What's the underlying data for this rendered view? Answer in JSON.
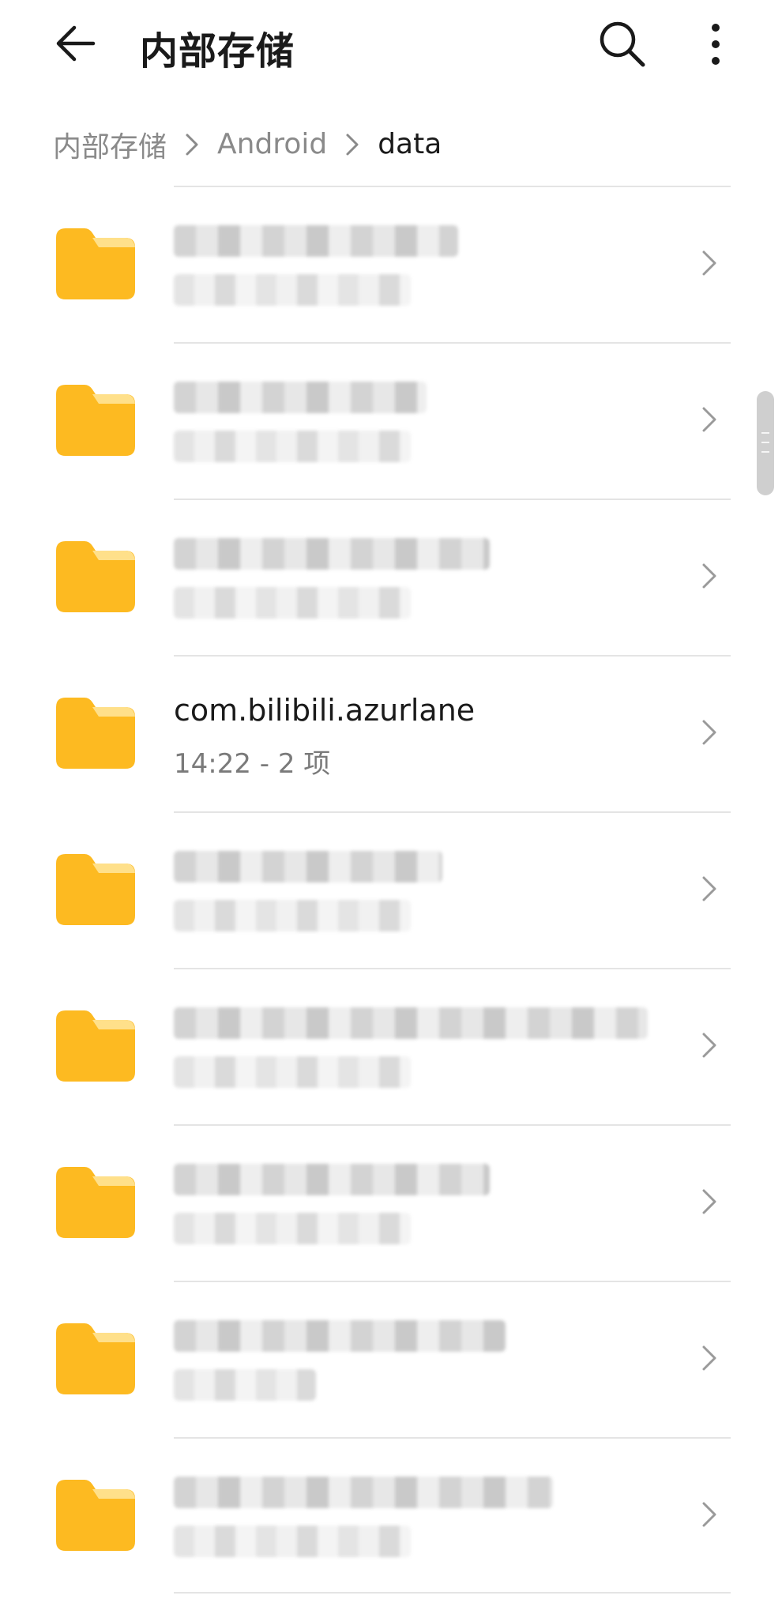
{
  "header": {
    "title": "内部存储",
    "icons": {
      "back": "arrow-left-icon",
      "search": "search-icon",
      "more": "more-vertical-icon"
    }
  },
  "breadcrumb": {
    "items": [
      "内部存储",
      "Android",
      "data"
    ]
  },
  "folders": [
    {
      "name": "",
      "meta": "",
      "redacted": true
    },
    {
      "name": "",
      "meta": "",
      "redacted": true
    },
    {
      "name": "",
      "meta": "",
      "redacted": true
    },
    {
      "name": "com.bilibili.azurlane",
      "meta": "14:22 - 2 项",
      "redacted": false
    },
    {
      "name": "",
      "meta": "",
      "redacted": true
    },
    {
      "name": "",
      "meta": "",
      "redacted": true
    },
    {
      "name": "",
      "meta": "",
      "redacted": true
    },
    {
      "name": "",
      "meta": "",
      "redacted": true
    },
    {
      "name": "",
      "meta": "",
      "redacted": true
    }
  ],
  "colors": {
    "folder": "#FDBA21",
    "folder_tab": "#FFE08A",
    "breadcrumb_inactive": "#8a8a8a",
    "divider": "#e4e4e4"
  }
}
